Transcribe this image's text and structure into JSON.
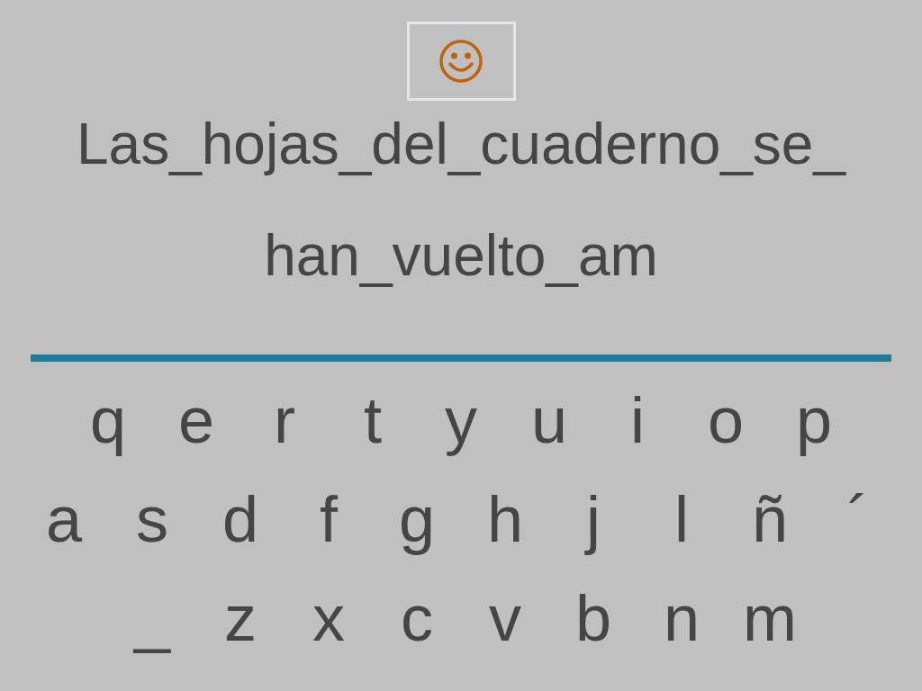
{
  "phrase_lines": [
    "Las_hojas_del_cuaderno_se_",
    "han_vuelto_am"
  ],
  "keyboard_rows": [
    [
      "q",
      "e",
      "r",
      "t",
      "y",
      "u",
      "i",
      "o",
      "p"
    ],
    [
      "a",
      "s",
      "d",
      "f",
      "g",
      "h",
      "j",
      "l",
      "ñ",
      "´"
    ],
    [
      "_",
      "z",
      "x",
      "c",
      "v",
      "b",
      "n",
      "m"
    ]
  ]
}
